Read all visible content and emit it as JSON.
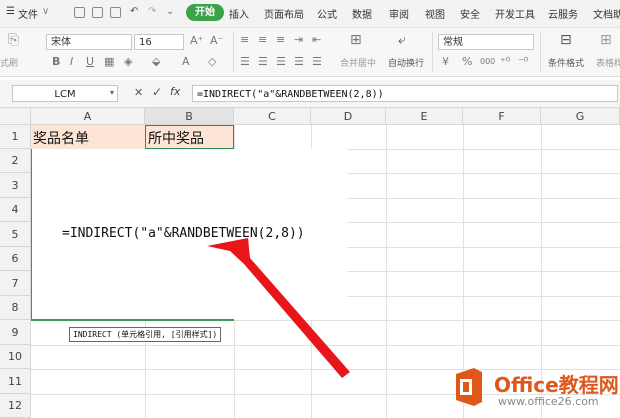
{
  "menu": {
    "file_label": "文件",
    "start_label": "开始",
    "tabs": [
      "插入",
      "页面布局",
      "公式",
      "数据",
      "审阅",
      "视图",
      "安全",
      "开发工具",
      "云服务",
      "文档助"
    ]
  },
  "toolbar": {
    "format_painter_label": "式刷",
    "font_name": "宋体",
    "font_size": "16",
    "increase_font": "A⁺",
    "decrease_font": "A⁻",
    "merge_center_label": "合并居中",
    "wrap_text_label": "自动换行",
    "number_format": "常规",
    "percent": "%",
    "thousands": "000",
    "conditional_format_label": "条件格式",
    "table_style_label": "表格样"
  },
  "formula_bar": {
    "name_box": "LCM",
    "fx_label": "fx",
    "cancel": "✕",
    "confirm": "✓",
    "formula": "=INDIRECT(\"a\"&RANDBETWEEN(2,8))"
  },
  "grid": {
    "columns": [
      "A",
      "B",
      "C",
      "D",
      "E",
      "F",
      "G"
    ],
    "rows": [
      "1",
      "2",
      "3",
      "4",
      "5",
      "6",
      "7",
      "8",
      "9",
      "10",
      "11",
      "12"
    ],
    "a1": "奖品名单",
    "b1": "所中奖品",
    "editing_formula": "=INDIRECT(\"a\"&RANDBETWEEN(2,8))",
    "tooltip": "INDIRECT (单元格引用, [引用样式])"
  },
  "watermark": {
    "title": "Office教程网",
    "url": "www.office26.com",
    "accent": "#e0571a"
  }
}
